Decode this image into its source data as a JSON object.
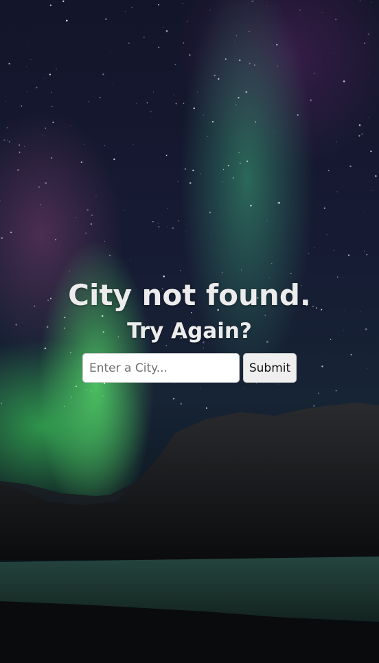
{
  "message": {
    "title": "City not found.",
    "subtitle": "Try Again?"
  },
  "search": {
    "placeholder": "Enter a City...",
    "value": "",
    "submit_label": "Submit"
  },
  "background": {
    "scene": "aurora-night-sky-mountains-lake",
    "colors": {
      "sky": "#161a33",
      "aurora_green": "#5ae66e",
      "aurora_purple": "#8c4678",
      "mountain": "#1b1c1f",
      "lake": "#1f3b38"
    }
  }
}
